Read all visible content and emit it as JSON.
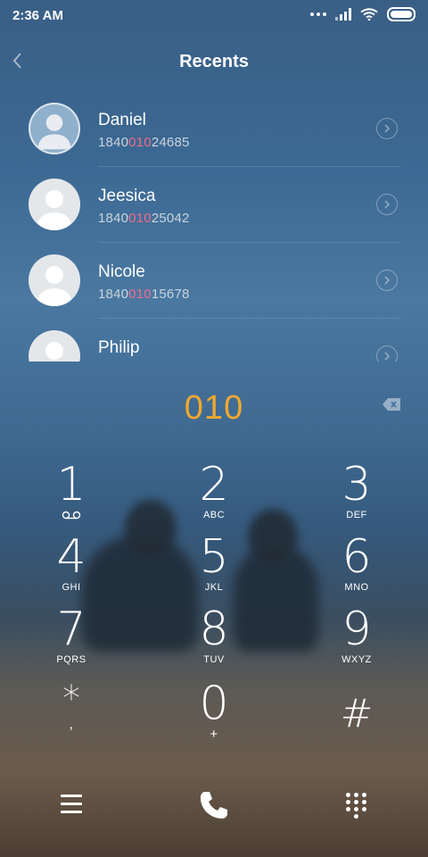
{
  "status_bar": {
    "time": "2:36 AM",
    "icons": [
      "more-dots-icon",
      "signal-icon",
      "wifi-icon",
      "battery-icon"
    ]
  },
  "header": {
    "title": "Recents",
    "back_icon": "chevron-left-icon"
  },
  "contacts": [
    {
      "name": "Daniel",
      "number_pre": "1840",
      "number_match": "010",
      "number_post": "24685",
      "avatar": "photo"
    },
    {
      "name": "Jeesica",
      "number_pre": "1840",
      "number_match": "010",
      "number_post": "25042",
      "avatar": "default"
    },
    {
      "name": "Nicole",
      "number_pre": "1840",
      "number_match": "010",
      "number_post": "15678",
      "avatar": "default"
    },
    {
      "name": "Philip",
      "number_pre": "",
      "number_match": "",
      "number_post": "",
      "avatar": "default"
    }
  ],
  "dialer": {
    "entered": "010",
    "backspace_icon": "backspace-icon"
  },
  "keypad": [
    {
      "digit": "1",
      "letters": "voicemail-icon"
    },
    {
      "digit": "2",
      "letters": "ABC"
    },
    {
      "digit": "3",
      "letters": "DEF"
    },
    {
      "digit": "4",
      "letters": "GHI"
    },
    {
      "digit": "5",
      "letters": "JKL"
    },
    {
      "digit": "6",
      "letters": "MNO"
    },
    {
      "digit": "7",
      "letters": "PQRS"
    },
    {
      "digit": "8",
      "letters": "TUV"
    },
    {
      "digit": "9",
      "letters": "WXYZ"
    },
    {
      "digit": "*",
      "letters": ","
    },
    {
      "digit": "0",
      "letters": "+"
    },
    {
      "digit": "#",
      "letters": ""
    }
  ],
  "bottom_bar": {
    "left_icon": "menu-icon",
    "center_icon": "phone-icon",
    "right_icon": "dialpad-icon"
  },
  "colors": {
    "match_highlight": "#f06a8a",
    "dial_digits": "#f1a82f"
  }
}
